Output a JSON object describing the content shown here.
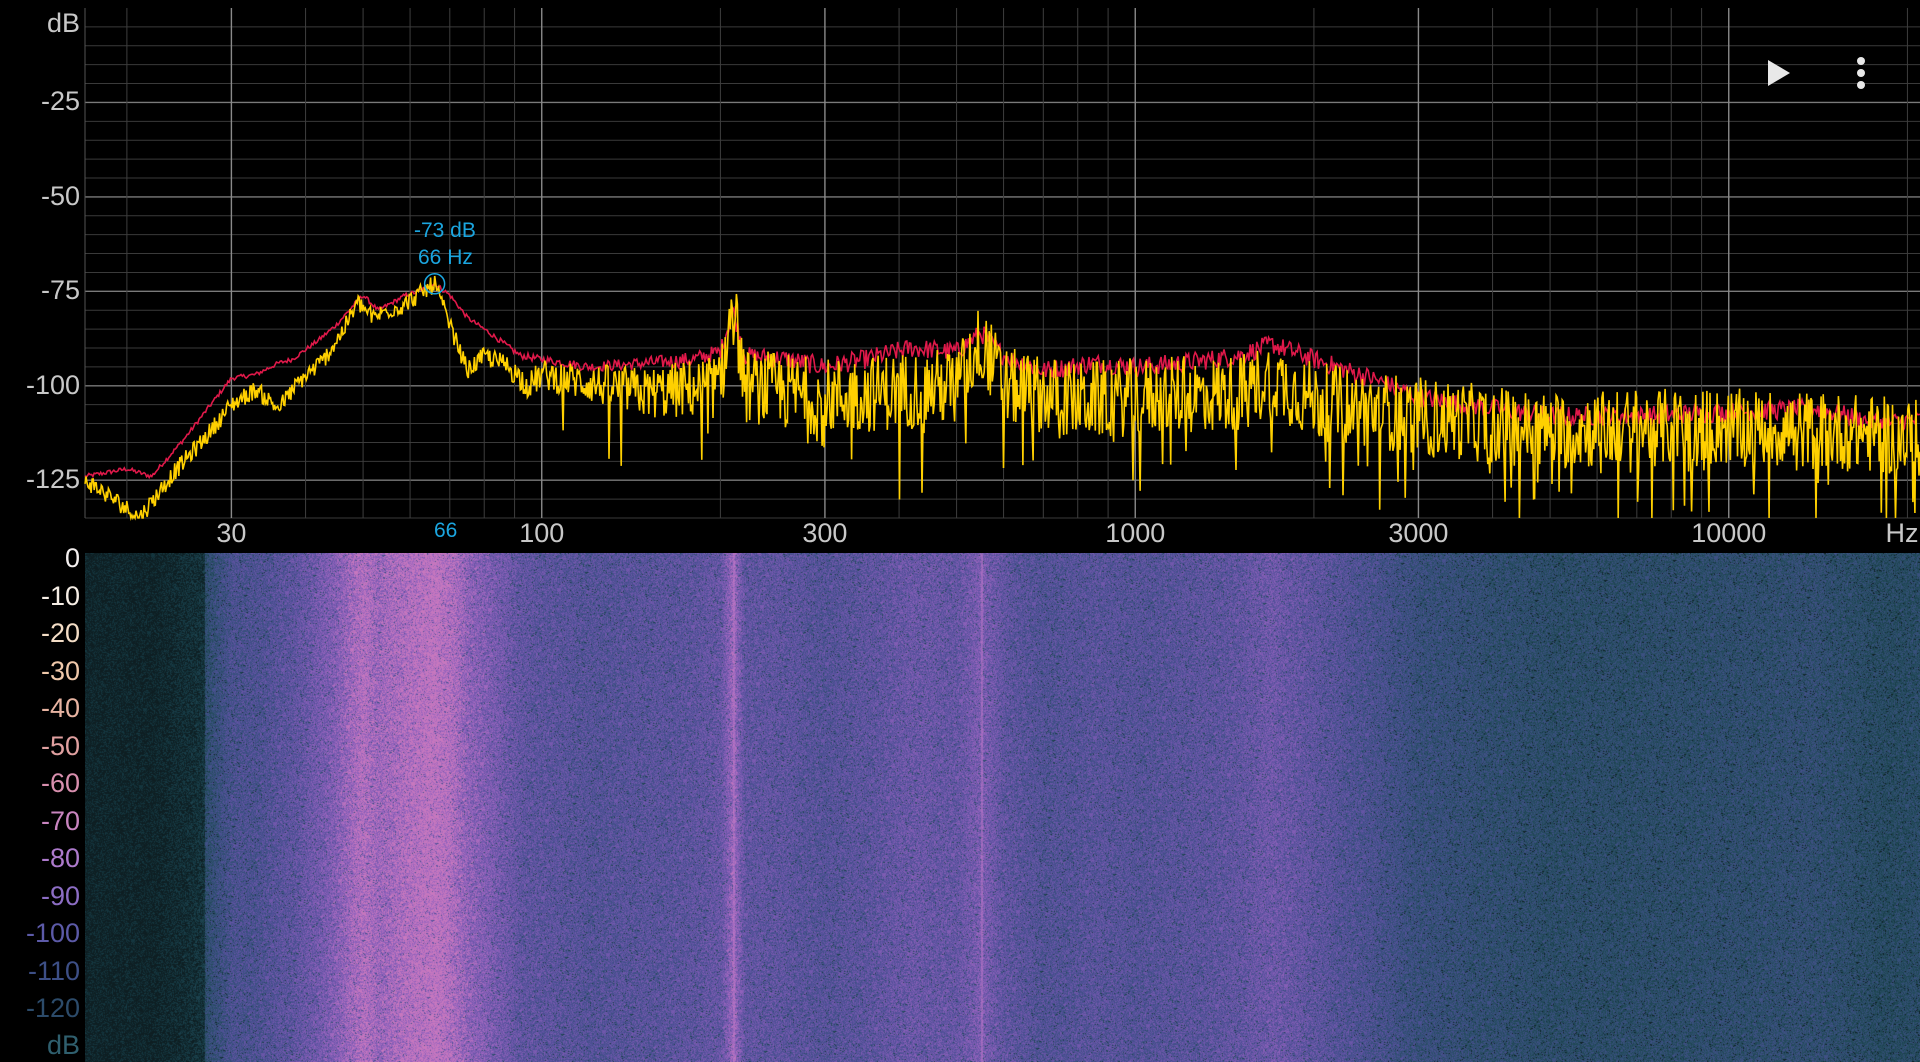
{
  "toolbar": {
    "play_icon": "play-icon",
    "menu_icon": "more-vert-icon"
  },
  "peak_marker": {
    "level": "-73 dB",
    "freq": "66 Hz",
    "axis_tag": "66",
    "color": "#1ba6e0"
  },
  "colors": {
    "current": "#ffd000",
    "peak_hold": "#e0194a",
    "grid": "#4a4a4a",
    "text": "#c8c8c8"
  },
  "spectrum": {
    "y_unit": "dB",
    "y_ticks": [
      "-25",
      "-50",
      "-75",
      "-100",
      "-125"
    ],
    "x_unit": "Hz",
    "x_ticks": [
      "30",
      "100",
      "300",
      "1000",
      "3000",
      "10000"
    ]
  },
  "spectrogram": {
    "scale_ticks": [
      "0",
      "-10",
      "-20",
      "-30",
      "-40",
      "-50",
      "-60",
      "-70",
      "-80",
      "-90",
      "-100",
      "-110",
      "-120"
    ],
    "scale_unit": "dB"
  },
  "chart_data": {
    "type": "line",
    "x_scale": "log",
    "xlim": [
      17,
      21000
    ],
    "ylim": [
      -135,
      0
    ],
    "series": [],
    "points_hz_db": {
      "peak_hold": [
        [
          17,
          -124
        ],
        [
          20,
          -122
        ],
        [
          22,
          -124
        ],
        [
          25,
          -114
        ],
        [
          28,
          -104
        ],
        [
          30,
          -98
        ],
        [
          33,
          -97
        ],
        [
          36,
          -94
        ],
        [
          38,
          -93
        ],
        [
          42,
          -88
        ],
        [
          45,
          -84
        ],
        [
          48,
          -79
        ],
        [
          50,
          -76
        ],
        [
          53,
          -80
        ],
        [
          56,
          -78
        ],
        [
          59,
          -76
        ],
        [
          62,
          -75
        ],
        [
          66,
          -73
        ],
        [
          70,
          -76
        ],
        [
          75,
          -82
        ],
        [
          80,
          -85
        ],
        [
          85,
          -88
        ],
        [
          92,
          -92
        ],
        [
          100,
          -93
        ],
        [
          120,
          -95
        ],
        [
          150,
          -94
        ],
        [
          180,
          -93
        ],
        [
          200,
          -91
        ],
        [
          210,
          -80
        ],
        [
          220,
          -92
        ],
        [
          260,
          -93
        ],
        [
          300,
          -95
        ],
        [
          350,
          -93
        ],
        [
          420,
          -90
        ],
        [
          500,
          -91
        ],
        [
          550,
          -86
        ],
        [
          600,
          -92
        ],
        [
          700,
          -96
        ],
        [
          850,
          -94
        ],
        [
          1000,
          -95
        ],
        [
          1200,
          -94
        ],
        [
          1500,
          -92
        ],
        [
          1700,
          -89
        ],
        [
          2000,
          -93
        ],
        [
          2500,
          -98
        ],
        [
          3000,
          -103
        ],
        [
          4000,
          -106
        ],
        [
          5000,
          -108
        ],
        [
          7000,
          -108
        ],
        [
          10000,
          -107
        ],
        [
          14000,
          -106
        ],
        [
          18000,
          -110
        ],
        [
          21000,
          -109
        ]
      ],
      "current": [
        [
          17,
          -125
        ],
        [
          19,
          -130
        ],
        [
          21,
          -135
        ],
        [
          24,
          -123
        ],
        [
          27,
          -114
        ],
        [
          30,
          -105
        ],
        [
          33,
          -101
        ],
        [
          36,
          -106
        ],
        [
          39,
          -99
        ],
        [
          43,
          -93
        ],
        [
          46,
          -86
        ],
        [
          49,
          -78
        ],
        [
          52,
          -82
        ],
        [
          55,
          -80
        ],
        [
          58,
          -79
        ],
        [
          62,
          -76
        ],
        [
          66,
          -73
        ],
        [
          70,
          -84
        ],
        [
          75,
          -96
        ],
        [
          80,
          -92
        ],
        [
          88,
          -95
        ],
        [
          95,
          -100
        ],
        [
          100,
          -97
        ],
        [
          150,
          -102
        ],
        [
          200,
          -100
        ],
        [
          210,
          -78
        ],
        [
          220,
          -100
        ],
        [
          300,
          -103
        ],
        [
          500,
          -100
        ],
        [
          550,
          -88
        ],
        [
          600,
          -100
        ],
        [
          800,
          -104
        ],
        [
          1000,
          -103
        ],
        [
          1500,
          -102
        ],
        [
          1700,
          -98
        ],
        [
          2000,
          -104
        ],
        [
          3000,
          -108
        ],
        [
          5000,
          -112
        ],
        [
          7000,
          -111
        ],
        [
          10000,
          -111
        ],
        [
          15000,
          -112
        ],
        [
          21000,
          -114
        ]
      ]
    }
  }
}
